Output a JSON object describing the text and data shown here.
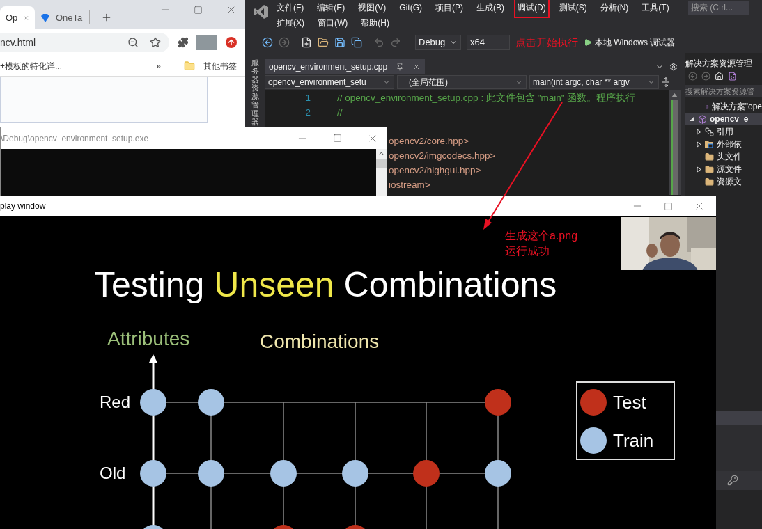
{
  "browser": {
    "tabs": [
      {
        "label": "Op",
        "selected": true
      },
      {
        "label": "OneTa",
        "selected": false
      }
    ],
    "address": "ncv.html",
    "bookmarks": [
      {
        "label": "+模板的特化详...",
        "kind": "link"
      },
      {
        "label": "»",
        "kind": "overflow"
      },
      {
        "label": "其他书签",
        "kind": "folder"
      }
    ]
  },
  "ide": {
    "menu_rows": [
      [
        {
          "label": "文件(F)",
          "boxed": false
        },
        {
          "label": "编辑(E)",
          "boxed": false
        },
        {
          "label": "视图(V)",
          "boxed": false
        },
        {
          "label": "Git(G)",
          "boxed": false
        },
        {
          "label": "项目(P)",
          "boxed": false
        },
        {
          "label": "生成(B)",
          "boxed": false
        },
        {
          "label": "调试(D)",
          "boxed": true
        },
        {
          "label": "测试(S)",
          "boxed": false
        },
        {
          "label": "分析(N)",
          "boxed": false
        },
        {
          "label": "工具(T)",
          "boxed": false
        }
      ],
      [
        {
          "label": "扩展(X)",
          "boxed": false
        },
        {
          "label": "窗口(W)",
          "boxed": false
        },
        {
          "label": "帮助(H)",
          "boxed": false
        }
      ]
    ],
    "search": {
      "placeholder": "搜索 (Ctrl..."
    },
    "toolbar": {
      "configuration": "Debug",
      "platform": "x64",
      "run": "本地 Windows 调试器"
    },
    "side_tab": "服务器资源管理器",
    "editor": {
      "tab": "opencv_environment_setup.cpp",
      "nav": [
        "opencv_environment_setu",
        "(全局范围)",
        "main(int argc, char ** argv"
      ],
      "lines": [
        {
          "number": "1",
          "text": "// opencv_environment_setup.cpp : 此文件包含 \"main\" 函数。程序执行",
          "kind": "comment"
        },
        {
          "number": "2",
          "text": "//",
          "kind": "comment"
        }
      ],
      "includes": [
        "opencv2/core.hpp>",
        "opencv2/imgcodecs.hpp>",
        "opencv2/highgui.hpp>",
        "iostream>"
      ]
    },
    "solution_explorer": {
      "title": "解决方案资源管理",
      "search": {
        "placeholder": "搜索解决方案资源管"
      },
      "tree": [
        {
          "label": "解决方案\"ope",
          "kind": "solution",
          "expandable": false,
          "selected": false
        },
        {
          "label": "opencv_e",
          "kind": "project",
          "expandable": true,
          "expanded": true,
          "selected": true,
          "children": [
            {
              "label": "引用",
              "kind": "references",
              "expandable": true,
              "expanded": false,
              "selected": false
            },
            {
              "label": "外部依",
              "kind": "external",
              "expandable": true,
              "expanded": false,
              "selected": false
            },
            {
              "label": "头文件",
              "kind": "folder",
              "expandable": false,
              "selected": false
            },
            {
              "label": "源文件",
              "kind": "folder",
              "expandable": true,
              "expanded": false,
              "selected": false
            },
            {
              "label": "资源文",
              "kind": "folder",
              "expandable": false,
              "selected": false
            }
          ]
        }
      ]
    }
  },
  "console": {
    "title": "\\Debug\\opencv_environment_setup.exe"
  },
  "display": {
    "title": "play window",
    "slide": {
      "title": {
        "before": "Testing",
        "highlight": "Unseen",
        "after": "Combinations"
      },
      "axis_label": "Attributes",
      "heading": "Combinations",
      "rows": [
        {
          "label": "Red",
          "cells": [
            {
              "kind": "train"
            },
            {
              "kind": "train"
            },
            {
              "kind": "empty"
            },
            {
              "kind": "empty"
            },
            {
              "kind": "empty"
            },
            {
              "kind": "test"
            }
          ]
        },
        {
          "label": "Old",
          "cells": [
            {
              "kind": "train"
            },
            {
              "kind": "train"
            },
            {
              "kind": "train"
            },
            {
              "kind": "train"
            },
            {
              "kind": "test"
            },
            {
              "kind": "train"
            }
          ]
        },
        {
          "cells": [
            {
              "kind": "train"
            },
            {
              "kind": "empty"
            },
            {
              "kind": "test"
            },
            {
              "kind": "test"
            },
            {
              "kind": "empty"
            },
            {
              "kind": "empty"
            }
          ]
        }
      ],
      "legend": [
        {
          "kind": "test",
          "label": "Test"
        },
        {
          "kind": "train",
          "label": "Train"
        }
      ]
    }
  },
  "annotations": [
    {
      "kind": "arrow"
    },
    {
      "kind": "note",
      "lines": [
        "点击开始执行"
      ]
    },
    {
      "kind": "note",
      "lines": [
        "生成这个a.png",
        "运行成功"
      ]
    }
  ]
}
